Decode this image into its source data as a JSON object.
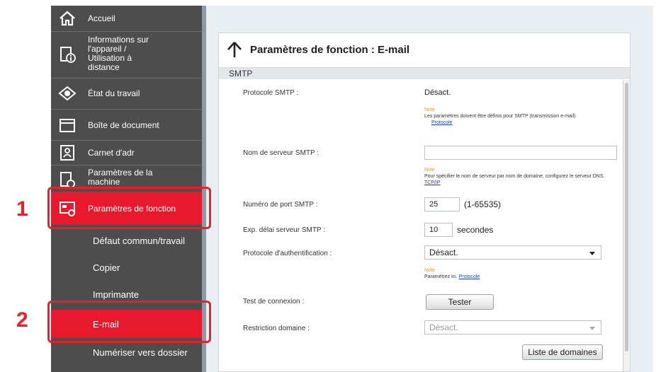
{
  "steps": {
    "first": "1",
    "second": "2"
  },
  "sidebar": {
    "items": [
      {
        "label": "Accueil",
        "icon": "home-icon"
      },
      {
        "label": "Informations sur l'appareil / Utilisation à distance",
        "icon": "device-info-icon"
      },
      {
        "label": "État du travail",
        "icon": "eye-icon"
      },
      {
        "label": "Boîte de document",
        "icon": "folder-icon"
      },
      {
        "label": "Carnet d'adr",
        "icon": "address-book-icon"
      },
      {
        "label": "Paramètres de la machine",
        "icon": "machine-settings-icon"
      },
      {
        "label": "Paramètres de fonction",
        "icon": "function-settings-icon"
      }
    ],
    "subitems": [
      {
        "label": "Défaut commun/travail"
      },
      {
        "label": "Copier"
      },
      {
        "label": "Imprimante"
      },
      {
        "label": "E-mail"
      },
      {
        "label": "Numériser vers dossier"
      }
    ]
  },
  "panel": {
    "title": "Paramètres de fonction : E-mail",
    "section": "SMTP",
    "rows": {
      "smtp_protocol": {
        "label": "Protocole SMTP :",
        "value": "Désact."
      },
      "note1": {
        "title": "Note",
        "text": "Les paramètres doivent être définis pour SMTP (transmission e-mail)",
        "link": "Protocole"
      },
      "server_name": {
        "label": "Nom de serveur SMTP :",
        "value": ""
      },
      "note2": {
        "title": "Note",
        "text": "Pour spécifier le nom de serveur par nom de domaine, configurez le serveur DNS.",
        "link": "TCP/IP"
      },
      "port": {
        "label": "Numéro de port SMTP :",
        "value": "25",
        "range": "(1-65535)"
      },
      "timeout": {
        "label": "Exp. délai serveur SMTP :",
        "value": "10",
        "unit": "secondes"
      },
      "auth": {
        "label": "Protocole d'authentification :",
        "value": "Désact."
      },
      "note3": {
        "title": "Note",
        "text": "Paramétrez ici.",
        "link": "Protocole"
      },
      "connection_test": {
        "label": "Test de connexion :",
        "button": "Tester"
      },
      "domain_restriction": {
        "label": "Restriction domaine :",
        "value": "Désact."
      },
      "domain_list_button": "Liste de domaines"
    }
  },
  "colors": {
    "sidebar": "#4d4d4d",
    "active": "#e8192c",
    "highlight": "#e8202a",
    "link": "#1a3fb5",
    "note": "#e39a1a"
  }
}
